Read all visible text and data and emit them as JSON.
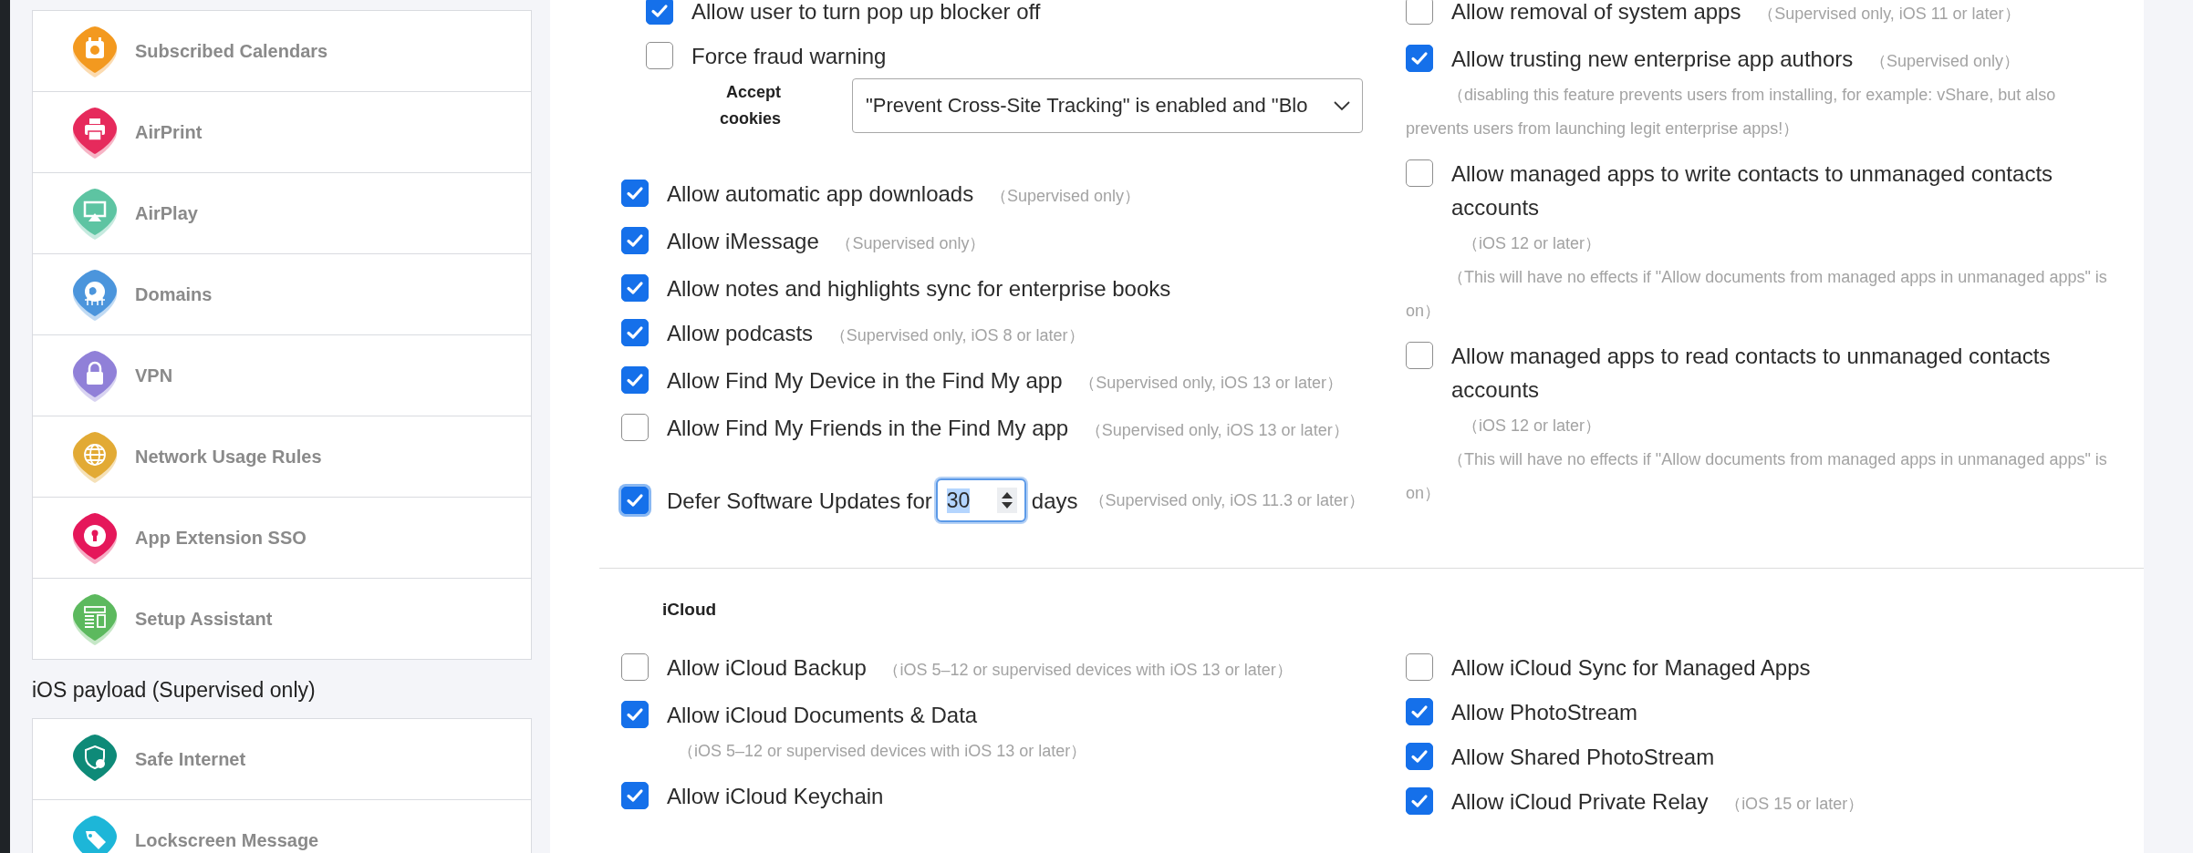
{
  "sidebar": {
    "items": [
      {
        "label": "Subscribed Calendars"
      },
      {
        "label": "AirPrint"
      },
      {
        "label": "AirPlay"
      },
      {
        "label": "Domains"
      },
      {
        "label": "VPN"
      },
      {
        "label": "Network Usage Rules"
      },
      {
        "label": "App Extension SSO"
      },
      {
        "label": "Setup Assistant"
      }
    ],
    "section_heading": "iOS payload (Supervised only)",
    "section_items": [
      {
        "label": "Safe Internet"
      },
      {
        "label": "Lockscreen Message"
      }
    ]
  },
  "safari": {
    "options": [
      {
        "label": "Allow user to turn pop up blocker off",
        "checked": true
      },
      {
        "label": "Force fraud warning",
        "checked": false
      }
    ],
    "cookies": {
      "label": "Accept cookies",
      "value": "\"Prevent Cross-Site Tracking\" is enabled and \"Blo"
    }
  },
  "left_options": [
    {
      "label": "Allow automatic app downloads",
      "checked": true,
      "hint": "（Supervised only）"
    },
    {
      "label": "Allow iMessage",
      "checked": true,
      "hint": "（Supervised only）"
    },
    {
      "label": "Allow notes and highlights sync for enterprise books",
      "checked": true
    },
    {
      "label": "Allow podcasts",
      "checked": true,
      "hint": "（Supervised only, iOS 8 or later）"
    },
    {
      "label": "Allow Find My Device in the Find My app",
      "checked": true,
      "hint": "（Supervised only, iOS 13 or later）"
    },
    {
      "label": "Allow Find My Friends in the Find My app",
      "checked": false,
      "hint": "（Supervised only, iOS 13 or later）"
    }
  ],
  "defer": {
    "checked": true,
    "label": "Defer Software Updates for",
    "value": "30",
    "unit": "days",
    "hint": "（Supervised only, iOS 11.3 or later）"
  },
  "right_options": [
    {
      "label": "Allow removal of system apps",
      "checked": false,
      "hint": "（Supervised only, iOS 11 or later）"
    },
    {
      "label": "Allow trusting new enterprise app authors",
      "checked": true,
      "hint": "（Supervised only）",
      "note": "（disabling this feature prevents users from installing, for example: vShare, but also prevents users from launching legit enterprise apps!）"
    },
    {
      "label": "Allow managed apps to write contacts to unmanaged contacts accounts",
      "checked": false,
      "hint": "（iOS 12 or later）",
      "note": "（This will have no effects if \"Allow documents from managed apps in unmanaged apps\" is on）"
    },
    {
      "label": "Allow managed apps to read contacts to unmanaged contacts accounts",
      "checked": false,
      "hint": "（iOS 12 or later）",
      "note": "（This will have no effects if \"Allow documents from managed apps in unmanaged apps\" is on）"
    }
  ],
  "icloud": {
    "title": "iCloud",
    "left_options": [
      {
        "label": "Allow iCloud Backup",
        "checked": false,
        "hint": "（iOS 5–12 or supervised devices with iOS 13 or later）"
      },
      {
        "label": "Allow iCloud Documents & Data",
        "checked": true,
        "hint": "（iOS 5–12 or supervised devices with iOS 13 or later）"
      },
      {
        "label": "Allow iCloud Keychain",
        "checked": true
      }
    ],
    "right_options": [
      {
        "label": "Allow iCloud Sync for Managed Apps",
        "checked": false
      },
      {
        "label": "Allow PhotoStream",
        "checked": true
      },
      {
        "label": "Allow Shared PhotoStream",
        "checked": true
      },
      {
        "label": "Allow iCloud Private Relay",
        "checked": true,
        "hint": "（iOS 15 or later）"
      }
    ]
  }
}
